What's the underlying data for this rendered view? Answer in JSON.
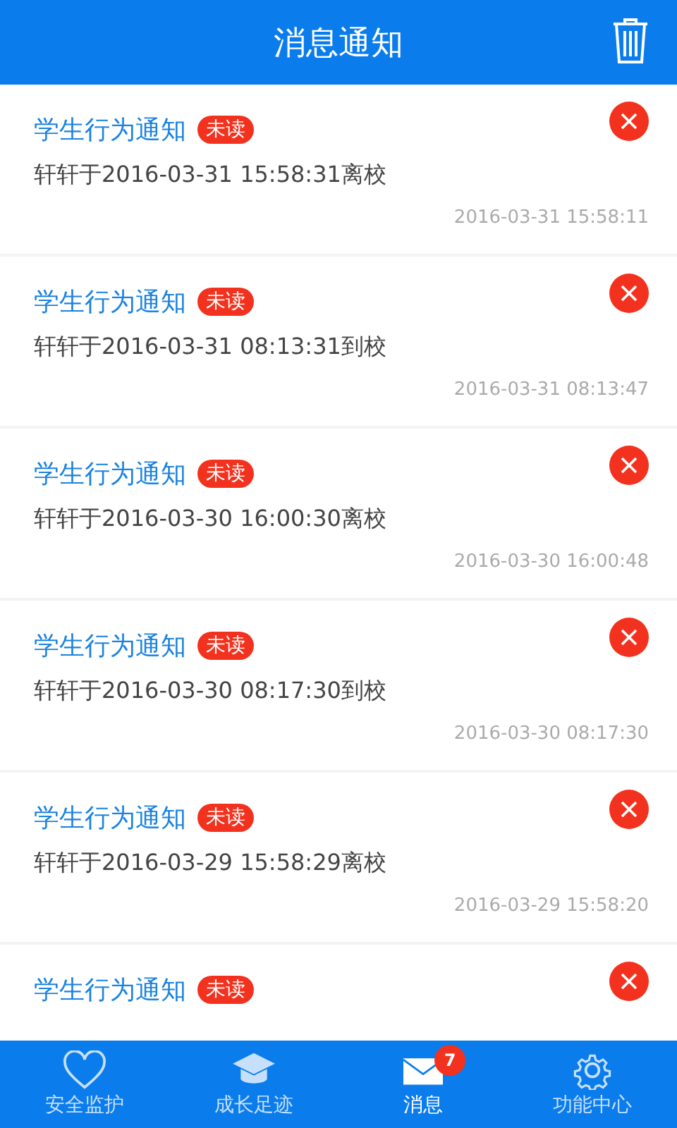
{
  "header": {
    "title": "消息通知"
  },
  "messages": [
    {
      "title": "学生行为通知",
      "badge": "未读",
      "body": "轩轩于2016-03-31 15:58:31离校",
      "time": "2016-03-31 15:58:11"
    },
    {
      "title": "学生行为通知",
      "badge": "未读",
      "body": "轩轩于2016-03-31 08:13:31到校",
      "time": "2016-03-31 08:13:47"
    },
    {
      "title": "学生行为通知",
      "badge": "未读",
      "body": "轩轩于2016-03-30 16:00:30离校",
      "time": "2016-03-30 16:00:48"
    },
    {
      "title": "学生行为通知",
      "badge": "未读",
      "body": "轩轩于2016-03-30 08:17:30到校",
      "time": "2016-03-30 08:17:30"
    },
    {
      "title": "学生行为通知",
      "badge": "未读",
      "body": "轩轩于2016-03-29 15:58:29离校",
      "time": "2016-03-29 15:58:20"
    },
    {
      "title": "学生行为通知",
      "badge": "未读"
    }
  ],
  "tabs": [
    {
      "kind": "heart",
      "label": "安全监护",
      "selected": false
    },
    {
      "kind": "cap",
      "label": "成长足迹",
      "selected": false
    },
    {
      "kind": "mail",
      "label": "消息",
      "selected": true,
      "badge": "7"
    },
    {
      "kind": "gear",
      "label": "功能中心",
      "selected": false
    }
  ]
}
